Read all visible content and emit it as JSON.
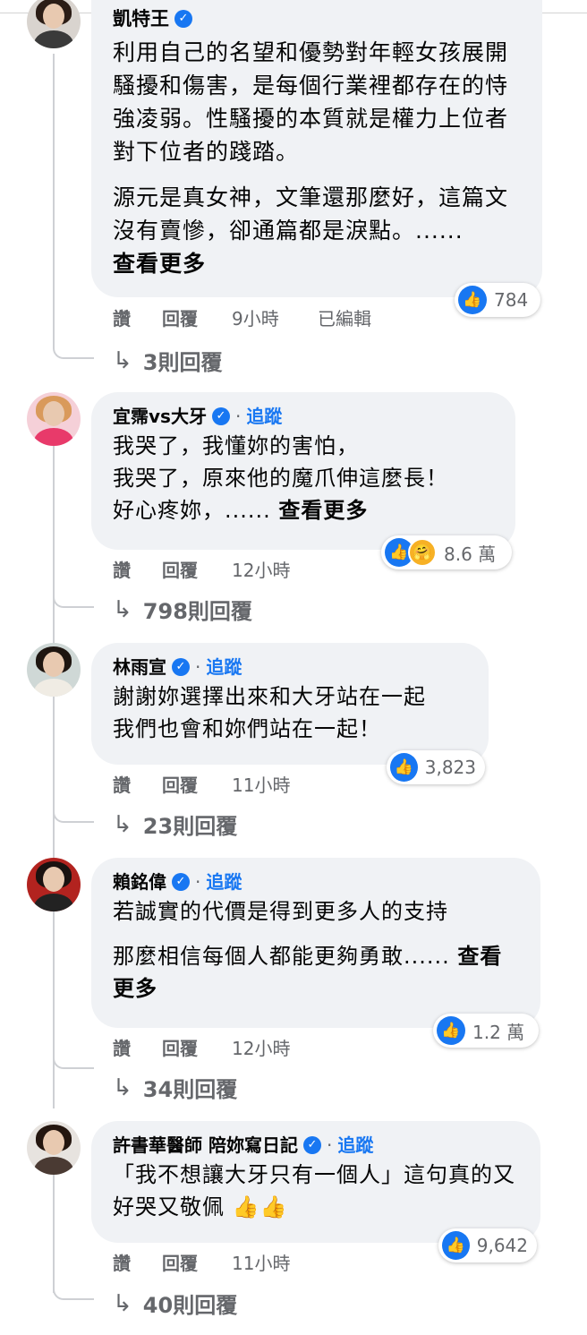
{
  "comments": [
    {
      "name": "凱特王",
      "verified": true,
      "follow": "",
      "paragraphs": [
        "利用自己的名望和優勢對年輕女孩展開騷擾和傷害，是每個行業裡都存在的恃強凌弱。性騷擾的本質就是權力上位者對下位者的踐踏。",
        "源元是真女神，文筆還那麼好，這篇文沒有賣慘，卻通篇都是淚點。......"
      ],
      "see_more": "查看更多",
      "reaction_count": "784",
      "actions": {
        "like": "讚",
        "reply": "回覆",
        "time": "9小時",
        "edited": "已編輯"
      },
      "replies": "3則回覆"
    },
    {
      "name": "宜霈vs大牙",
      "verified": true,
      "follow": "追蹤",
      "lines": [
        "我哭了，我懂妳的害怕，",
        "我哭了，原來他的魔爪伸這麼長！",
        "好心疼妳，......"
      ],
      "see_more": "查看更多",
      "reaction_count": "8.6 萬",
      "actions": {
        "like": "讚",
        "reply": "回覆",
        "time": "12小時"
      },
      "replies": "798則回覆"
    },
    {
      "name": "林雨宣",
      "verified": true,
      "follow": "追蹤",
      "lines": [
        "謝謝妳選擇出來和大牙站在一起",
        "我們也會和妳們站在一起！"
      ],
      "reaction_count": "3,823",
      "actions": {
        "like": "讚",
        "reply": "回覆",
        "time": "11小時"
      },
      "replies": "23則回覆"
    },
    {
      "name": "賴銘偉",
      "verified": true,
      "follow": "追蹤",
      "paragraphs": [
        "若誠實的代價是得到更多人的支持",
        "那麼相信每個人都能更夠勇敢......"
      ],
      "see_more": "查看更多",
      "reaction_count": "1.2 萬",
      "actions": {
        "like": "讚",
        "reply": "回覆",
        "time": "12小時"
      },
      "replies": "34則回覆"
    },
    {
      "name": "許書華醫師 陪妳寫日記",
      "verified": true,
      "follow": "追蹤",
      "text": "「我不想讓大牙只有一個人」這句真的又好哭又敬佩",
      "emoji": "👍👍",
      "reaction_count": "9,642",
      "actions": {
        "like": "讚",
        "reply": "回覆",
        "time": "11小時"
      },
      "replies": "40則回覆"
    }
  ],
  "colors": {
    "bubble": "#f0f2f5",
    "link": "#1877f2",
    "meta": "#65676b",
    "like": "#1877f2",
    "care": "#f7b125"
  },
  "icons": {
    "verified": "verified-badge-icon",
    "like": "like-reaction-icon",
    "care": "care-reaction-icon",
    "reply_arrow": "reply-arrow-icon"
  }
}
